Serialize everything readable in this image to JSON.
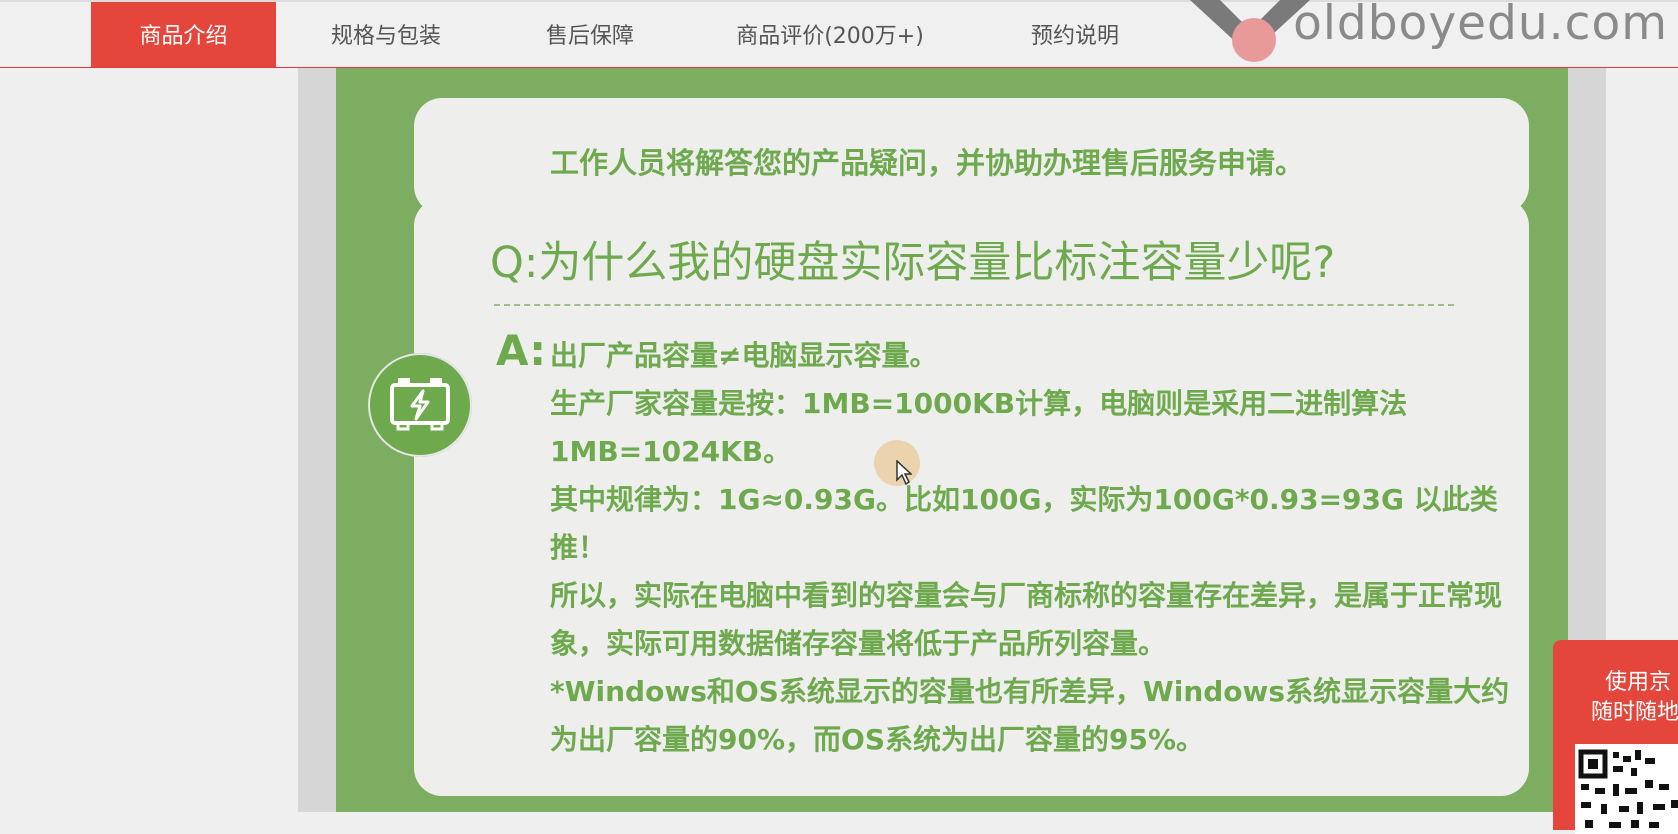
{
  "tabs": [
    {
      "label": "商品介绍",
      "active": true
    },
    {
      "label": "规格与包装",
      "active": false
    },
    {
      "label": "售后保障",
      "active": false
    },
    {
      "label": "商品评价(200万+)",
      "active": false
    },
    {
      "label": "预约说明",
      "active": false
    }
  ],
  "watermark": "oldboyedu.com",
  "top_card": {
    "line": "工作人员将解答您的产品疑问，并协助办理售后服务申请。"
  },
  "qa": {
    "question": "Q:为什么我的硬盘实际容量比标注容量少呢?",
    "a_label": "A:",
    "answers": [
      "出厂产品容量≠电脑显示容量。",
      "生产厂家容量是按：1MB=1000KB计算，电脑则是采用二进制算法1MB=1024KB。",
      "其中规律为：1G≈0.93G。比如100G，实际为100G*0.93=93G 以此类推！",
      "所以，实际在电脑中看到的容量会与厂商标称的容量存在差异，是属于正常现象，实际可用数据储存容量将低于产品所列容量。",
      "*Windows和OS系统显示的容量也有所差异，Windows系统显示容量大约为出厂容量的90%，而OS系统为出厂容量的95%。"
    ]
  },
  "promo": {
    "line1": "使用京",
    "line2": "随时随地"
  },
  "colors": {
    "accent": "#e4463c",
    "green": "#7dad60",
    "text_green": "#6ea94e"
  },
  "icons": {
    "battery": "battery-charging-icon",
    "cursor": "mouse-cursor-icon",
    "logo": "watermark-logo-icon",
    "qr": "qr-code-icon"
  }
}
